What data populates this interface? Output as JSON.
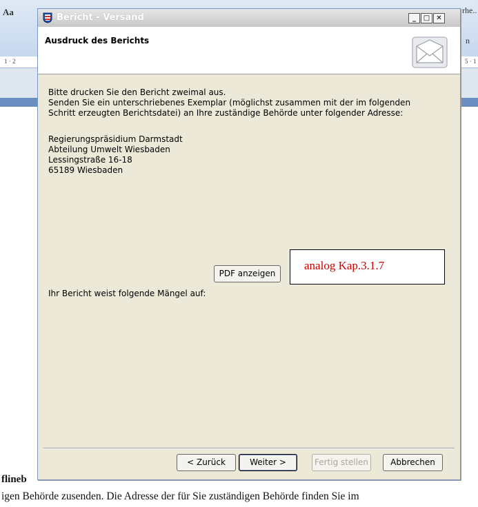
{
  "background": {
    "ribbon_text_left": "Aa",
    "ribbon_text_right_top": "rhe..",
    "ribbon_text_right_mid": "n",
    "ruler_left": "1 · 2",
    "ruler_right": "5 · 1",
    "doc_fragment_1": "flineb",
    "doc_fragment_2": "igen Behörde zusenden. Die Adresse der für Sie zuständigen Behörde finden Sie im"
  },
  "dialog": {
    "title": "Bericht - Versand",
    "header_title": "Ausdruck des Berichts",
    "window_buttons": {
      "minimize": "_",
      "maximize": "□",
      "close": "✕"
    },
    "body_lines": [
      "Bitte drucken Sie den Bericht zweimal aus.",
      "Senden Sie ein unterschriebenes Exemplar (möglichst zusammen mit der im folgenden",
      "Schritt erzeugten Berichtsdatei) an Ihre zuständige Behörde unter folgender Adresse:"
    ],
    "address": [
      "Regierungspräsidium Darmstadt",
      "Abteilung Umwelt Wiesbaden",
      "Lessingstraße 16-18",
      "65189 Wiesbaden"
    ],
    "pdf_button": "PDF anzeigen",
    "defects_label": "Ihr Bericht weist folgende Mängel auf:",
    "annotation": "analog Kap.3.1.7",
    "buttons": {
      "back": "< Zurück",
      "next": "Weiter >",
      "finish": "Fertig stellen",
      "cancel": "Abbrechen"
    },
    "icons": {
      "app": "hesse-crest-icon",
      "header": "envelope-icon"
    },
    "colors": {
      "annotation_text": "#cc0000",
      "dialog_bg": "#ece9d8",
      "disabled_text": "#aca899"
    }
  }
}
